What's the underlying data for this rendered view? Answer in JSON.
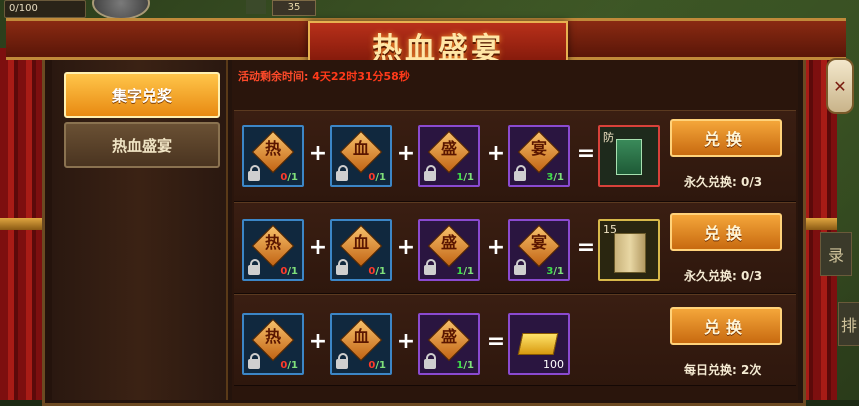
{
  "hud": {
    "counter": "0/100",
    "level": "35"
  },
  "title": "热血盛宴",
  "close_glyph": "✕",
  "side_tabs": [
    "录",
    "排"
  ],
  "sidebar": {
    "items": [
      {
        "label": "集字兑奖",
        "active": true
      },
      {
        "label": "热血盛宴",
        "active": false
      }
    ]
  },
  "timer": {
    "label": "活动剩余时间:",
    "value": "4天22时31分58秒"
  },
  "rows": [
    {
      "ingredients": [
        {
          "char": "热",
          "have": "0",
          "need": "1",
          "frame": "blue"
        },
        {
          "char": "血",
          "have": "0",
          "need": "1",
          "frame": "blue"
        },
        {
          "char": "盛",
          "have": "1",
          "need": "1",
          "frame": "purple"
        },
        {
          "char": "宴",
          "have": "3",
          "need": "1",
          "frame": "purple"
        }
      ],
      "reward": {
        "label": "防",
        "kind": "book",
        "frame": "red"
      },
      "button": "兑换",
      "limit": "永久兑换: 0/3"
    },
    {
      "ingredients": [
        {
          "char": "热",
          "have": "0",
          "need": "1",
          "frame": "blue"
        },
        {
          "char": "血",
          "have": "0",
          "need": "1",
          "frame": "blue"
        },
        {
          "char": "盛",
          "have": "1",
          "need": "1",
          "frame": "purple"
        },
        {
          "char": "宴",
          "have": "3",
          "need": "1",
          "frame": "purple"
        }
      ],
      "reward": {
        "label": "15",
        "kind": "scroll",
        "frame": "gold"
      },
      "button": "兑换",
      "limit": "永久兑换: 0/3"
    },
    {
      "ingredients": [
        {
          "char": "热",
          "have": "0",
          "need": "1",
          "frame": "blue"
        },
        {
          "char": "血",
          "have": "0",
          "need": "1",
          "frame": "blue"
        },
        {
          "char": "盛",
          "have": "1",
          "need": "1",
          "frame": "purple"
        }
      ],
      "reward": {
        "label": "",
        "kind": "gold",
        "amount": "100",
        "frame": "purple"
      },
      "button": "兑换",
      "limit": "每日兑换: 2次"
    }
  ],
  "colors": {
    "accent": "#f4a63a",
    "timer": "#ff3a1a",
    "count_missing": "#ff3a2a",
    "count_ok": "#3ee04a"
  }
}
